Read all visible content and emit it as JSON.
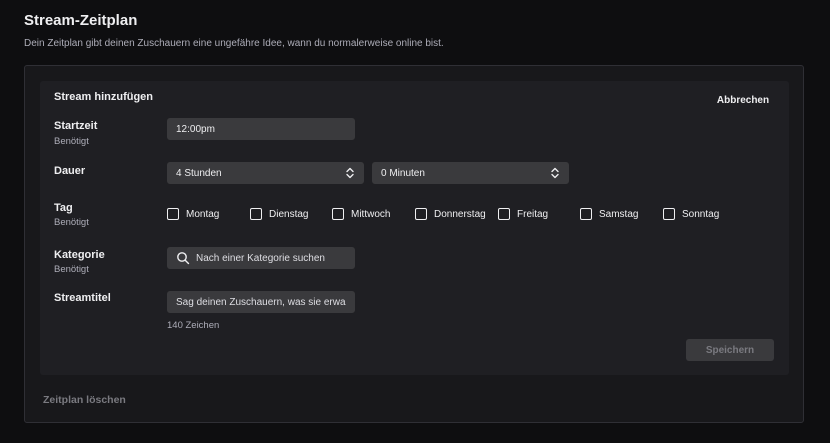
{
  "page": {
    "title": "Stream-Zeitplan",
    "subtitle": "Dein Zeitplan gibt deinen Zuschauern eine ungefähre Idee, wann du normalerweise online bist."
  },
  "form": {
    "title": "Stream hinzufügen",
    "cancel_label": "Abbrechen",
    "start_time": {
      "label": "Startzeit",
      "sublabel": "Benötigt",
      "value": "12:00pm"
    },
    "duration": {
      "label": "Dauer",
      "hours_value": "4 Stunden",
      "minutes_value": "0 Minuten"
    },
    "day": {
      "label": "Tag",
      "sublabel": "Benötigt",
      "options": [
        "Montag",
        "Dienstag",
        "Mittwoch",
        "Donnerstag",
        "Freitag",
        "Samstag",
        "Sonntag"
      ]
    },
    "category": {
      "label": "Kategorie",
      "sublabel": "Benötigt",
      "placeholder": "Nach einer Kategorie suchen"
    },
    "stream_title": {
      "label": "Streamtitel",
      "placeholder": "Sag deinen Zuschauern, was sie erwartet.",
      "char_count": "140 Zeichen"
    },
    "save_label": "Speichern"
  },
  "delete_label": "Zeitplan löschen",
  "colors": {
    "background": "#0e0e10",
    "card": "#18181b",
    "inner_card": "#1f1f23",
    "field": "#3a3a3d",
    "text": "#efeff1",
    "muted": "#adadb8"
  },
  "icons": {
    "select": "chevron-up-down-icon",
    "search": "search-icon",
    "checkbox": "checkbox-icon"
  }
}
